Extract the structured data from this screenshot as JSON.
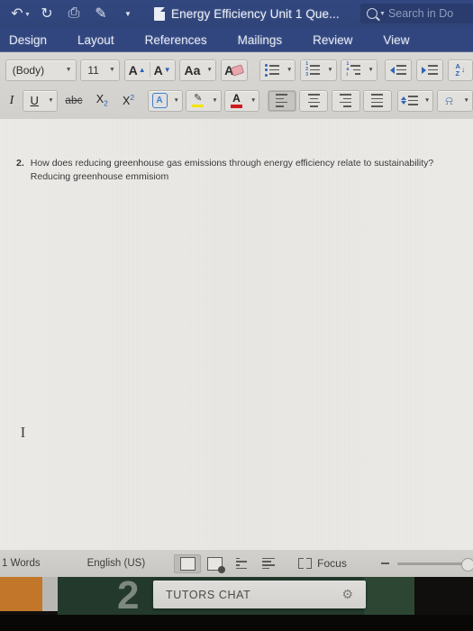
{
  "window": {
    "app": "Microsoft Word",
    "document_title": "Energy Efficiency Unit 1 Que...",
    "doc_icon": "document-icon",
    "quick_access": [
      {
        "name": "undo-icon",
        "glyph": "↶",
        "has_caret": true
      },
      {
        "name": "redo-icon",
        "glyph": "↻",
        "has_caret": false
      },
      {
        "name": "print-icon",
        "glyph": "⎙",
        "has_caret": false
      },
      {
        "name": "edit-mode-icon",
        "glyph": "✎",
        "has_caret": false
      },
      {
        "name": "customize-quick-access-icon",
        "glyph": "▼",
        "has_caret": false
      }
    ],
    "search": {
      "placeholder": "Search in Do",
      "icon": "search-icon"
    }
  },
  "ribbon": {
    "tabs": [
      "Design",
      "Layout",
      "References",
      "Mailings",
      "Review",
      "View"
    ],
    "font_group": {
      "font_name": "(Body)",
      "font_size": "11",
      "grow_font": "A",
      "shrink_font": "A",
      "change_case": "Aa",
      "clear_formatting": "A",
      "italic": "I",
      "underline": "U",
      "strikethrough": "abc",
      "subscript": "X",
      "subscript_sub": "2",
      "superscript": "X",
      "superscript_sup": "2",
      "text_effects": "A",
      "highlight": "✎",
      "font_color": "A"
    },
    "paragraph_group": {
      "bullets": "bullets-icon",
      "numbering": "numbering-icon",
      "multilevel": "multilevel-list-icon",
      "decrease_indent": "decrease-indent-icon",
      "increase_indent": "increase-indent-icon",
      "sort": "sort-az-icon",
      "align_left": "align-left-icon",
      "align_center": "align-center-icon",
      "align_right": "align-right-icon",
      "justify": "justify-icon",
      "line_spacing": "line-spacing-icon",
      "shading": "shading-icon",
      "sort_label_a": "A",
      "sort_label_z": "Z"
    }
  },
  "document": {
    "question_number": "2.",
    "question_text": "How does reducing greenhouse gas emissions through energy efficiency relate to sustainability?",
    "answer_text": "Reducing greenhouse emmisiom",
    "cursor": "I"
  },
  "status_bar": {
    "word_count": "1 Words",
    "language": "English (US)",
    "views": [
      {
        "name": "print-layout-view",
        "selected": true
      },
      {
        "name": "web-layout-view",
        "selected": false
      },
      {
        "name": "outline-view",
        "selected": false
      },
      {
        "name": "draft-view",
        "selected": false
      }
    ],
    "focus_label": "Focus",
    "zoom_out": "−"
  },
  "overlay": {
    "chat_label": "TUTORS CHAT",
    "settings_icon": "gear-icon",
    "background_digit": "2"
  },
  "colors": {
    "titlebar": "#31467e",
    "ribbon": "#d7d5d1",
    "page": "#e9e7e3",
    "accent_blue": "#2f63b8",
    "highlight_yellow": "#f2e400",
    "font_color_red": "#d0181e"
  }
}
